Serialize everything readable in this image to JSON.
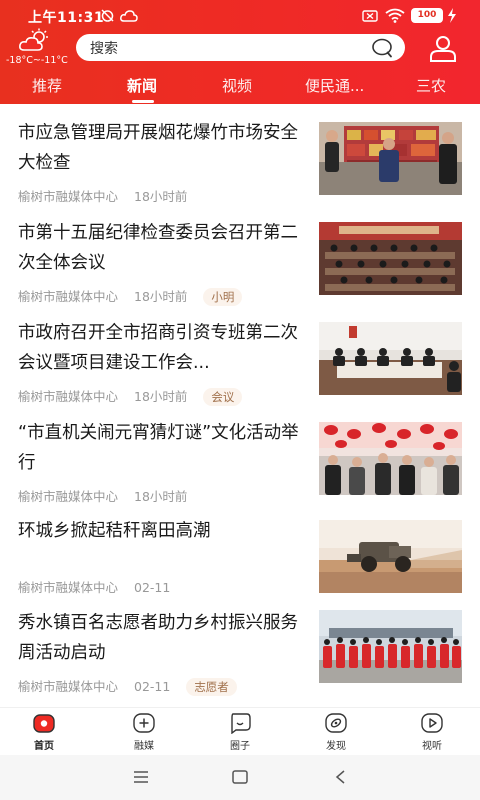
{
  "status_bar": {
    "time": "上午11:31",
    "battery": "100"
  },
  "header": {
    "weather": {
      "temperature": "-18°C~-11°C",
      "icon": "cloudy-sun-icon"
    },
    "search": {
      "placeholder": "搜索"
    },
    "tabs": [
      {
        "label": "推荐",
        "active": false
      },
      {
        "label": "新闻",
        "active": true
      },
      {
        "label": "视频",
        "active": false
      },
      {
        "label": "便民通...",
        "active": false
      },
      {
        "label": "三农",
        "active": false
      }
    ]
  },
  "news": [
    {
      "title": "市应急管理局开展烟花爆竹市场安全大检查",
      "source": "榆树市融媒体中心",
      "time": "18小时前",
      "tag": ""
    },
    {
      "title": "市第十五届纪律检查委员会召开第二次全体会议",
      "source": "榆树市融媒体中心",
      "time": "18小时前",
      "tag": "小明"
    },
    {
      "title": "市政府召开全市招商引资专班第二次会议暨项目建设工作会...",
      "source": "榆树市融媒体中心",
      "time": "18小时前",
      "tag": "会议"
    },
    {
      "title": "“市直机关闹元宵猜灯谜”文化活动举行",
      "source": "榆树市融媒体中心",
      "time": "18小时前",
      "tag": ""
    },
    {
      "title": "环城乡掀起秸秆离田高潮",
      "source": "榆树市融媒体中心",
      "time": "02-11",
      "tag": ""
    },
    {
      "title": "秀水镇百名志愿者助力乡村振兴服务周活动启动",
      "source": "榆树市融媒体中心",
      "time": "02-11",
      "tag": "志愿者"
    }
  ],
  "bottom_tabs": [
    {
      "label": "首页",
      "icon": "home-icon",
      "active": true
    },
    {
      "label": "融媒",
      "icon": "plus-circle-icon",
      "active": false
    },
    {
      "label": "圈子",
      "icon": "chat-bubble-icon",
      "active": false
    },
    {
      "label": "发现",
      "icon": "compass-icon",
      "active": false
    },
    {
      "label": "视听",
      "icon": "play-icon",
      "active": false
    }
  ],
  "colors": {
    "brand_red": "#ee2b24",
    "tag_text": "#a1714c",
    "tag_bg": "#fbf3ec",
    "meta_text": "#999999"
  }
}
